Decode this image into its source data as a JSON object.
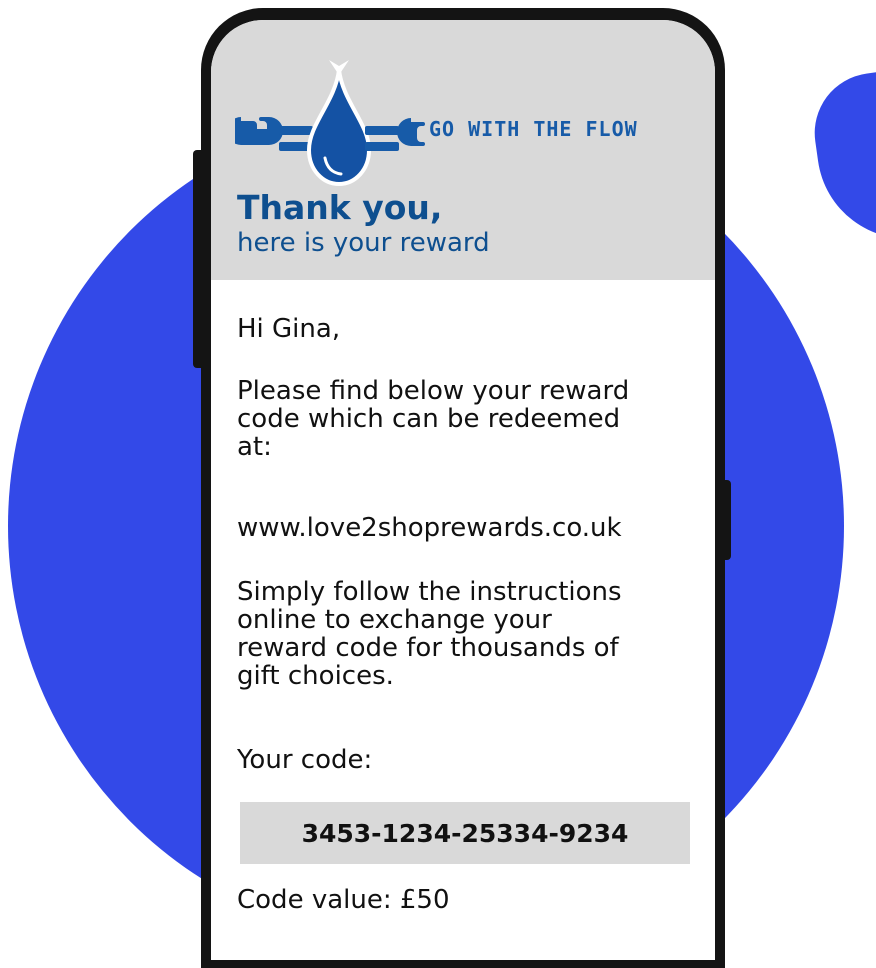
{
  "brand": {
    "name": "GO WITH THE FLOW",
    "logo_icon": "water-drop-wrench-icon",
    "primary_color": "#175ba8",
    "background_accent": "#3349e8"
  },
  "header": {
    "title": "Thank you,",
    "subtitle": "here is your reward"
  },
  "message": {
    "greeting": "Hi Gina,",
    "intro_lines": [
      "Please find below your reward",
      "code which can be redeemed",
      "at:"
    ],
    "url": "www.love2shoprewards.co.uk",
    "instructions_lines": [
      "Simply follow the instructions",
      "online to exchange your",
      "reward code  for thousands of",
      "gift choices."
    ],
    "code_label": "Your code:",
    "code": "3453-1234-25334-9234",
    "code_value": "Code value: £50"
  }
}
